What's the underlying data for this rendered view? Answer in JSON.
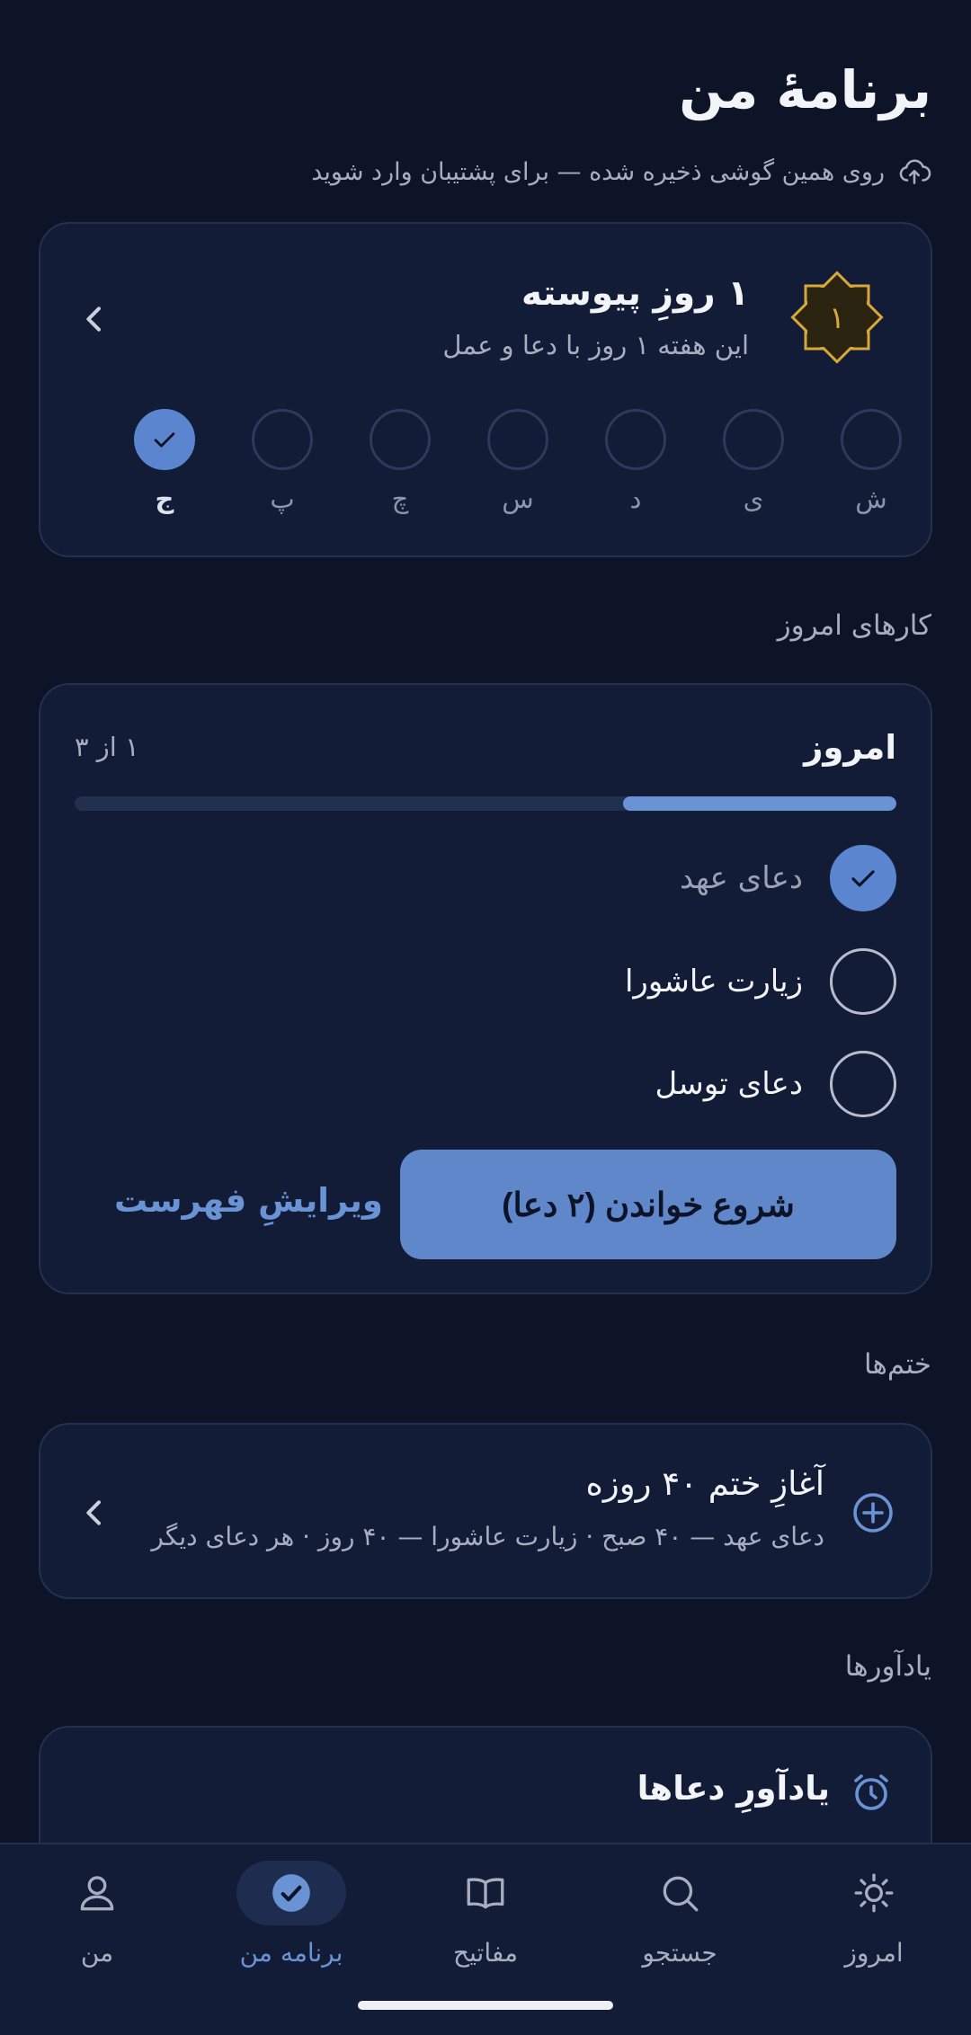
{
  "header": {
    "title": "برنامهٔ من",
    "sync_text": "روی همین گوشی ذخیره شده — برای پشتیبان وارد شوید"
  },
  "streak": {
    "badge_number": "۱",
    "title": "۱ روزِ پیوسته",
    "subtitle": "این هفته ۱ روز با دعا و عمل",
    "days": [
      {
        "label": "ش",
        "done": false
      },
      {
        "label": "ی",
        "done": false
      },
      {
        "label": "د",
        "done": false
      },
      {
        "label": "س",
        "done": false
      },
      {
        "label": "چ",
        "done": false
      },
      {
        "label": "پ",
        "done": false
      },
      {
        "label": "ج",
        "done": true
      }
    ]
  },
  "sections": {
    "today_tasks": "کارهای امروز",
    "khatms": "ختم‌ها",
    "reminders": "یادآورها"
  },
  "today": {
    "title": "امروز",
    "count": "۱ از ۳",
    "progress": 0.333,
    "tasks": [
      {
        "label": "دعای عهد",
        "done": true
      },
      {
        "label": "زیارت عاشورا",
        "done": false
      },
      {
        "label": "دعای توسل",
        "done": false
      }
    ],
    "start_button": "شروع خواندن (۲ دعا)",
    "edit_link": "ویرایشِ فهرست"
  },
  "khatm": {
    "title": "آغازِ ختم ۴۰ روزه",
    "subtitle": "دعای عهد — ۴۰ صبح · زیارت عاشورا — ۴۰ روز · هر دعای دیگر"
  },
  "reminder": {
    "title": "یادآورِ دعاها"
  },
  "nav": [
    {
      "label": "امروز",
      "icon": "sun-icon",
      "active": false
    },
    {
      "label": "جستجو",
      "icon": "search-icon",
      "active": false
    },
    {
      "label": "مفاتیح",
      "icon": "book-icon",
      "active": false
    },
    {
      "label": "برنامه من",
      "icon": "check-circle-icon",
      "active": true
    },
    {
      "label": "من",
      "icon": "person-icon",
      "active": false
    }
  ],
  "colors": {
    "background": "#0d1428",
    "card": "#131c36",
    "accent": "#5f87c9",
    "gold": "#d4a93a"
  }
}
